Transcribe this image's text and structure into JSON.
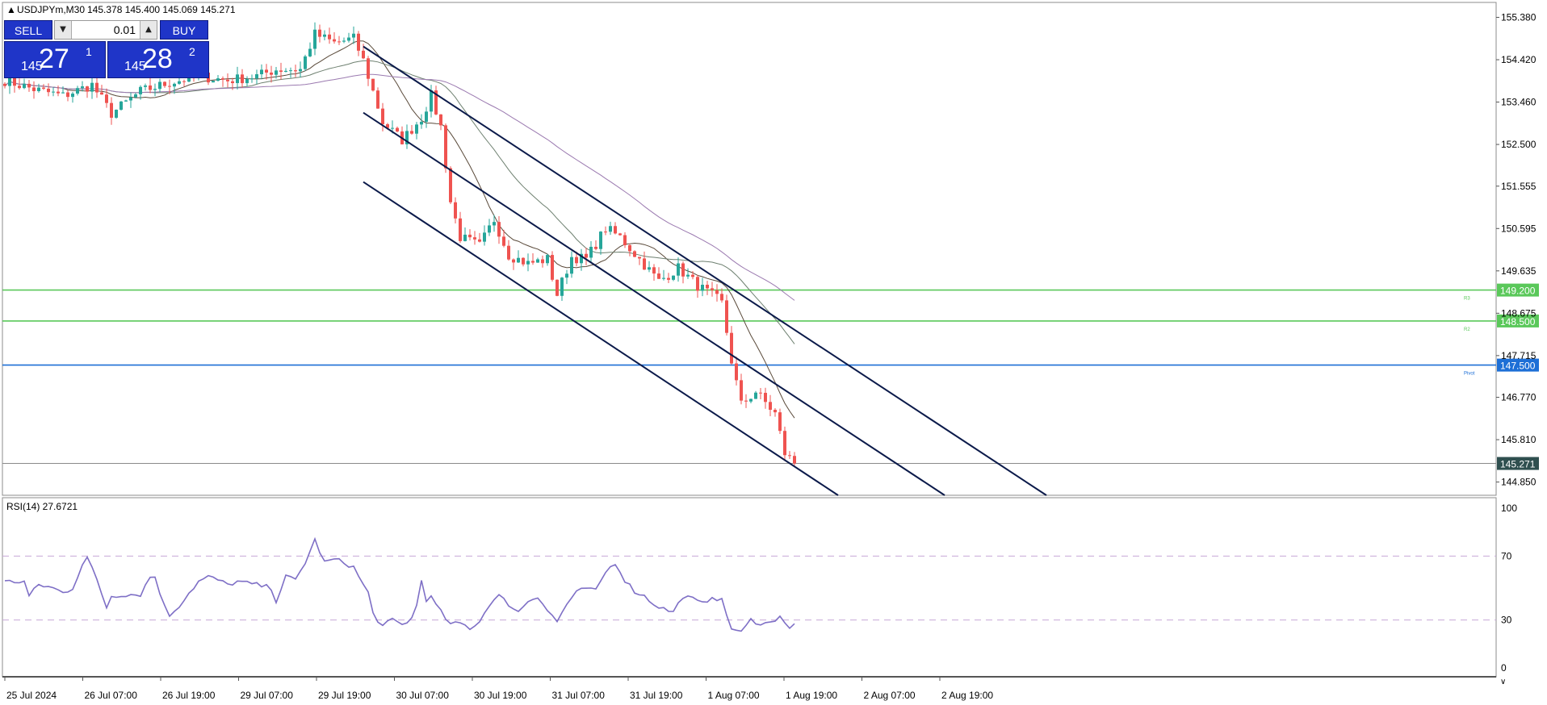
{
  "header": {
    "symbol": "USDJPYm,M30",
    "ohlc": "145.378 145.400 145.069 145.271"
  },
  "trade_panel": {
    "sell_label": "SELL",
    "buy_label": "BUY",
    "volume": "0.01",
    "sell_price_small": "145",
    "sell_price_big": "27",
    "sell_price_sup": "1",
    "buy_price_small": "145",
    "buy_price_big": "28",
    "buy_price_sup": "2"
  },
  "colors": {
    "bull": "#26a69a",
    "bear": "#ef5350",
    "support": "#5ac85a",
    "pivot": "#1d6fd6",
    "price_label_bg": "#2f4f4f",
    "rsi": "#7e6fc6",
    "channel": "#0b1a4a",
    "ma_fast": "#5a4a3a",
    "ma_mid": "#6e8070",
    "ma_slow": "#9b7ab0"
  },
  "chart_data": [
    {
      "type": "candlestick",
      "y_ticks": [
        155.38,
        154.42,
        153.46,
        152.5,
        151.555,
        150.595,
        149.635,
        148.675,
        147.715,
        146.77,
        145.81,
        144.85
      ],
      "y_tick_labels": [
        "155.380",
        "154.420",
        "153.460",
        "152.500",
        "151.555",
        "150.595",
        "149.635",
        "148.675",
        "147.715",
        "146.770",
        "145.810",
        "144.850"
      ],
      "ylim": [
        144.55,
        155.7
      ],
      "x_labels": [
        "25 Jul 2024",
        "26 Jul 07:00",
        "26 Jul 19:00",
        "29 Jul 07:00",
        "29 Jul 19:00",
        "30 Jul 07:00",
        "30 Jul 19:00",
        "31 Jul 07:00",
        "31 Jul 19:00",
        "1 Aug 07:00",
        "1 Aug 19:00",
        "2 Aug 07:00",
        "2 Aug 19:00"
      ],
      "n_bars": 164,
      "close_keypoints": [
        [
          0,
          153.95
        ],
        [
          6,
          153.75
        ],
        [
          12,
          153.6
        ],
        [
          18,
          153.85
        ],
        [
          22,
          153.2
        ],
        [
          28,
          153.7
        ],
        [
          34,
          153.9
        ],
        [
          40,
          154.05
        ],
        [
          46,
          153.95
        ],
        [
          52,
          154.05
        ],
        [
          56,
          154.2
        ],
        [
          61,
          154.2
        ],
        [
          64,
          155.0
        ],
        [
          68,
          154.8
        ],
        [
          72,
          154.9
        ],
        [
          74,
          154.4
        ],
        [
          78,
          153.0
        ],
        [
          82,
          152.6
        ],
        [
          86,
          153.1
        ],
        [
          88,
          153.6
        ],
        [
          90,
          152.9
        ],
        [
          92,
          151.2
        ],
        [
          94,
          150.4
        ],
        [
          98,
          150.2
        ],
        [
          101,
          150.8
        ],
        [
          104,
          150.0
        ],
        [
          108,
          149.8
        ],
        [
          112,
          149.9
        ],
        [
          114,
          149.1
        ],
        [
          117,
          149.95
        ],
        [
          120,
          149.9
        ],
        [
          124,
          150.6
        ],
        [
          127,
          150.4
        ],
        [
          131,
          149.9
        ],
        [
          135,
          149.4
        ],
        [
          139,
          149.7
        ],
        [
          143,
          149.3
        ],
        [
          147,
          149.0
        ],
        [
          148,
          148.9
        ],
        [
          150,
          147.6
        ],
        [
          152,
          146.6
        ],
        [
          155,
          146.9
        ],
        [
          159,
          146.4
        ],
        [
          161,
          145.5
        ],
        [
          163,
          145.27
        ]
      ],
      "horizontal_levels": [
        {
          "value": 149.2,
          "label": "149.200",
          "tag": "R3",
          "kind": "support"
        },
        {
          "value": 148.5,
          "label": "148.500",
          "tag": "R2",
          "kind": "support"
        },
        {
          "value": 147.5,
          "label": "147.500",
          "tag": "Pivot",
          "kind": "pivot"
        },
        {
          "value": 145.271,
          "label": "145.271",
          "tag": "",
          "kind": "price"
        }
      ],
      "channel_lines": [
        {
          "x1": 74,
          "y1": 154.72,
          "x2": 215,
          "y2": 144.55
        },
        {
          "x1": 74,
          "y1": 153.22,
          "x2": 194,
          "y2": 144.55
        },
        {
          "x1": 74,
          "y1": 151.65,
          "x2": 172,
          "y2": 144.55
        }
      ]
    },
    {
      "type": "line",
      "title": "RSI(14) 27.6721",
      "y_ticks": [
        100,
        70,
        30,
        0
      ],
      "y_tick_labels": [
        "100",
        "70",
        "30",
        "0"
      ],
      "ylim": [
        0,
        100
      ],
      "levels": [
        70,
        30
      ],
      "rsi_keypoints": [
        [
          0,
          54
        ],
        [
          4,
          54
        ],
        [
          5,
          45
        ],
        [
          7,
          52
        ],
        [
          10,
          50
        ],
        [
          12,
          47
        ],
        [
          14,
          50
        ],
        [
          16,
          65
        ],
        [
          17,
          69
        ],
        [
          19,
          55
        ],
        [
          21,
          38
        ],
        [
          22,
          45
        ],
        [
          25,
          46
        ],
        [
          28,
          46
        ],
        [
          30,
          57
        ],
        [
          31,
          57
        ],
        [
          33,
          38
        ],
        [
          34,
          33
        ],
        [
          36,
          39
        ],
        [
          38,
          47
        ],
        [
          40,
          54
        ],
        [
          42,
          57
        ],
        [
          44,
          55
        ],
        [
          46,
          52
        ],
        [
          48,
          54
        ],
        [
          50,
          53
        ],
        [
          52,
          52
        ],
        [
          55,
          50
        ],
        [
          56,
          42
        ],
        [
          58,
          57
        ],
        [
          60,
          55
        ],
        [
          62,
          66
        ],
        [
          64,
          80
        ],
        [
          66,
          66
        ],
        [
          68,
          68
        ],
        [
          70,
          66
        ],
        [
          72,
          63
        ],
        [
          74,
          52
        ],
        [
          75,
          47
        ],
        [
          76,
          34
        ],
        [
          78,
          26
        ],
        [
          80,
          30
        ],
        [
          82,
          27
        ],
        [
          84,
          31
        ],
        [
          85,
          39
        ],
        [
          86,
          55
        ],
        [
          87,
          43
        ],
        [
          88,
          44
        ],
        [
          90,
          35
        ],
        [
          92,
          27
        ],
        [
          94,
          28
        ],
        [
          96,
          25
        ],
        [
          98,
          29
        ],
        [
          100,
          40
        ],
        [
          102,
          45
        ],
        [
          104,
          40
        ],
        [
          106,
          35
        ],
        [
          108,
          42
        ],
        [
          110,
          45
        ],
        [
          112,
          36
        ],
        [
          114,
          29
        ],
        [
          116,
          40
        ],
        [
          118,
          47
        ],
        [
          120,
          50
        ],
        [
          122,
          48
        ],
        [
          124,
          60
        ],
        [
          126,
          66
        ],
        [
          128,
          55
        ],
        [
          130,
          48
        ],
        [
          132,
          45
        ],
        [
          134,
          40
        ],
        [
          136,
          37
        ],
        [
          138,
          35
        ],
        [
          140,
          45
        ],
        [
          142,
          43
        ],
        [
          144,
          40
        ],
        [
          146,
          45
        ],
        [
          148,
          42
        ],
        [
          149,
          33
        ],
        [
          150,
          25
        ],
        [
          152,
          22
        ],
        [
          154,
          30
        ],
        [
          156,
          28
        ],
        [
          158,
          28
        ],
        [
          160,
          33
        ],
        [
          162,
          24
        ],
        [
          163,
          28
        ]
      ]
    }
  ]
}
